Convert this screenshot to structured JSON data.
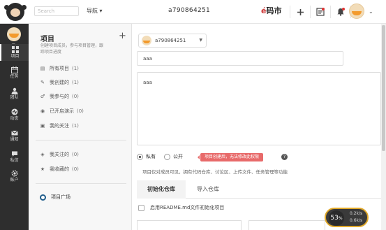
{
  "topbar": {
    "search_placeholder": "Search",
    "nav_label": "导航",
    "title": "a790864251",
    "brand_mark": "é",
    "brand_text": "码市"
  },
  "rail": [
    {
      "label": "项目",
      "icon": "grid-icon",
      "active": true
    },
    {
      "label": "任务",
      "icon": "calendar-icon",
      "active": false
    },
    {
      "label": "团队",
      "icon": "team-icon",
      "active": false
    },
    {
      "label": "动态",
      "icon": "pulse-icon",
      "active": false
    },
    {
      "label": "通知",
      "icon": "mail-icon",
      "active": false
    },
    {
      "label": "私信",
      "icon": "chat-icon",
      "active": false
    },
    {
      "label": "账户",
      "icon": "gear-icon",
      "active": false
    }
  ],
  "panel": {
    "title": "项目",
    "description": "创建项目成员，参与项目管理，跟踪项目进度",
    "items": [
      {
        "label": "所有项目",
        "count": "(1)",
        "icon": "list-icon"
      },
      {
        "label": "我创建的",
        "count": "(1)",
        "icon": "edit-icon"
      },
      {
        "label": "我参与的",
        "count": "(0)",
        "icon": "user-icon"
      },
      {
        "label": "已开启演示",
        "count": "(0)",
        "icon": "play-icon"
      },
      {
        "label": "我的关注",
        "count": "(1)",
        "icon": "archive-icon"
      }
    ],
    "items2": [
      {
        "label": "我关注的",
        "count": "(0)",
        "icon": "eye-icon"
      },
      {
        "label": "我收藏的",
        "count": "(0)",
        "icon": "star-icon"
      }
    ],
    "plaza_label": "项目广场"
  },
  "form": {
    "owner": "a790864251",
    "project_name": "aaa",
    "description": "aaa",
    "visibility": {
      "private_label": "私有",
      "public_label": "公开",
      "tip": "项目创建后，无法修改此权限",
      "help": "?",
      "note": "项目仅对成员可见，拥有代码仓库、讨论区、上传文件、任务管理等功能"
    },
    "tabs": [
      {
        "label": "初始化仓库",
        "active": true
      },
      {
        "label": "导入仓库",
        "active": false
      }
    ],
    "readme_label": "启用README.md文件初始化项目"
  },
  "widget": {
    "value": "53",
    "unit": "%",
    "line1": "0.2k/s",
    "line2": "0.6k/s"
  },
  "colors": {
    "rail_bg": "#2e2e2e",
    "tip_bg": "#e86a6a",
    "widget_border": "#e0a82a"
  }
}
